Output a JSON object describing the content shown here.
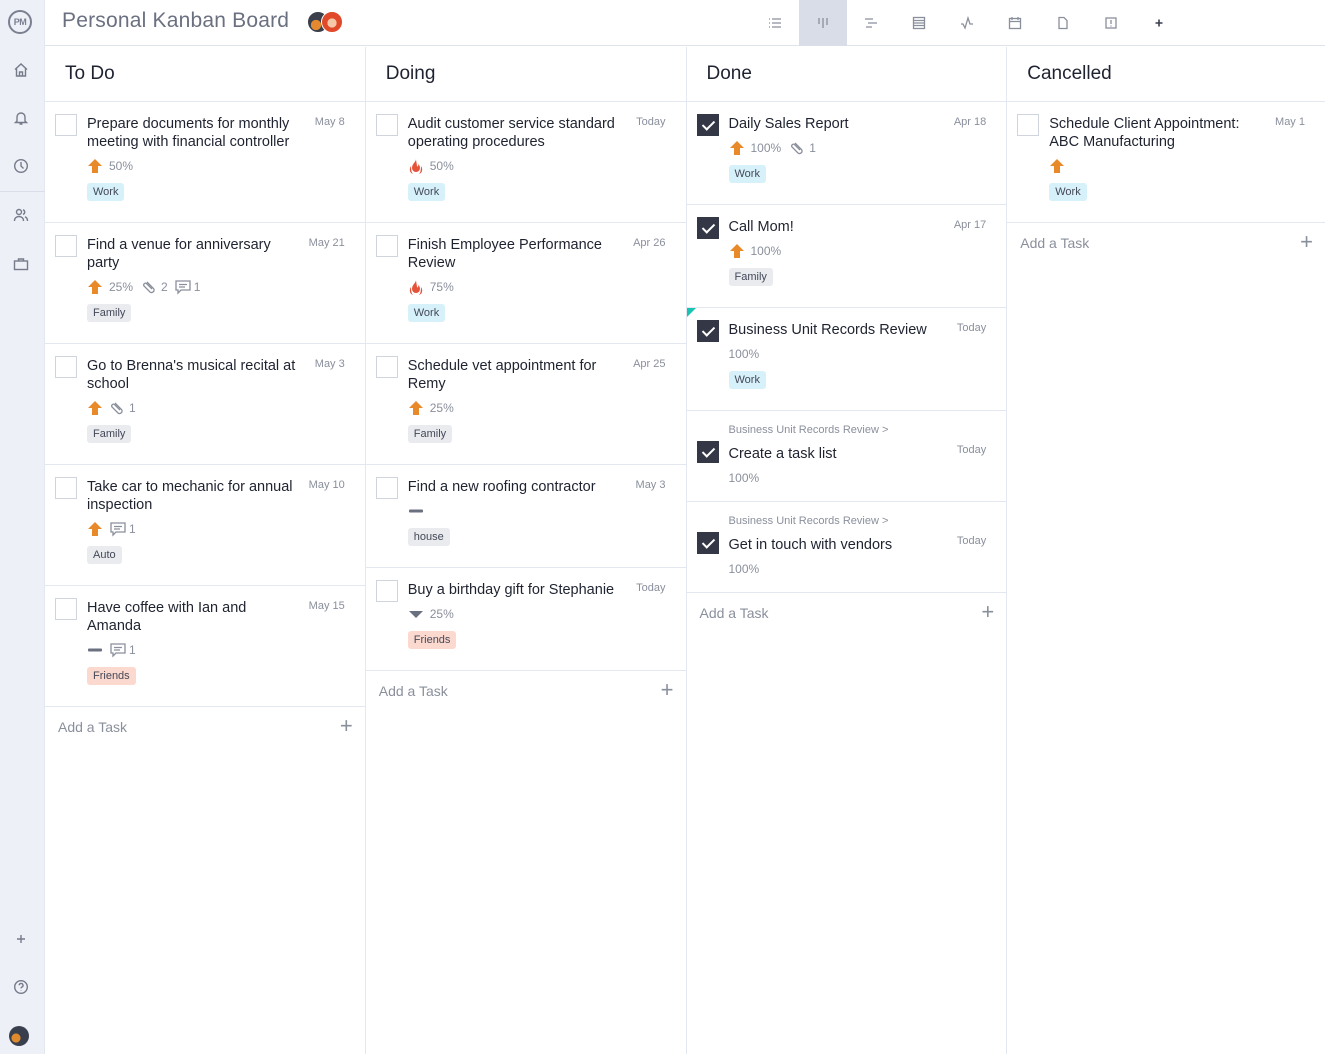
{
  "app": {
    "logo": "PM",
    "title": "Personal Kanban Board"
  },
  "sidebar": {
    "items": [
      {
        "icon": "home-icon",
        "label": "Home"
      },
      {
        "icon": "bell-icon",
        "label": "Notifications"
      },
      {
        "icon": "clock-icon",
        "label": "Recent"
      },
      {
        "icon": "users-icon",
        "label": "People"
      },
      {
        "icon": "briefcase-icon",
        "label": "Projects"
      }
    ],
    "bottom": [
      {
        "icon": "plus-icon",
        "label": "Add"
      },
      {
        "icon": "help-icon",
        "label": "Help"
      },
      {
        "icon": "user-avatar",
        "label": "Profile"
      }
    ]
  },
  "toolbar": {
    "views": [
      {
        "icon": "list-view-icon",
        "label": "List",
        "active": false
      },
      {
        "icon": "board-view-icon",
        "label": "Board",
        "active": true
      },
      {
        "icon": "gantt-view-icon",
        "label": "Gantt",
        "active": false
      },
      {
        "icon": "sheet-view-icon",
        "label": "Sheet",
        "active": false
      },
      {
        "icon": "dashboard-icon",
        "label": "Dashboard",
        "active": false
      },
      {
        "icon": "calendar-icon",
        "label": "Calendar",
        "active": false
      },
      {
        "icon": "files-icon",
        "label": "Files",
        "active": false
      },
      {
        "icon": "issues-icon",
        "label": "Issues",
        "active": false
      },
      {
        "icon": "add-view-icon",
        "label": "Add view",
        "active": false
      }
    ]
  },
  "columns": [
    {
      "title": "To Do",
      "add_label": "Add a Task",
      "cards": [
        {
          "name": "Prepare documents for monthly meeting with financial controller",
          "date": "May 8",
          "priority": "high",
          "progress": "50%",
          "attachments": null,
          "comments": null,
          "tag": "Work",
          "done": false
        },
        {
          "name": "Find a venue for anniversary party",
          "date": "May 21",
          "priority": "high",
          "progress": "25%",
          "attachments": "2",
          "comments": "1",
          "tag": "Family",
          "done": false
        },
        {
          "name": "Go to Brenna's musical recital at school",
          "date": "May 3",
          "priority": "high",
          "progress": null,
          "attachments": "1",
          "comments": null,
          "tag": "Family",
          "done": false
        },
        {
          "name": "Take car to mechanic for annual inspection",
          "date": "May 10",
          "priority": "high",
          "progress": null,
          "attachments": null,
          "comments": "1",
          "tag": "Auto",
          "done": false
        },
        {
          "name": "Have coffee with Ian and Amanda",
          "date": "May 15",
          "priority": "medium",
          "progress": null,
          "attachments": null,
          "comments": "1",
          "tag": "Friends",
          "done": false
        }
      ]
    },
    {
      "title": "Doing",
      "add_label": "Add a Task",
      "cards": [
        {
          "name": "Audit customer service standard operating procedures",
          "date": "Today",
          "priority": "critical",
          "progress": "50%",
          "attachments": null,
          "comments": null,
          "tag": "Work",
          "done": false
        },
        {
          "name": "Finish Employee Performance Review",
          "date": "Apr 26",
          "priority": "critical",
          "progress": "75%",
          "attachments": null,
          "comments": null,
          "tag": "Work",
          "done": false
        },
        {
          "name": "Schedule vet appointment for Remy",
          "date": "Apr 25",
          "priority": "high",
          "progress": "25%",
          "attachments": null,
          "comments": null,
          "tag": "Family",
          "done": false
        },
        {
          "name": "Find a new roofing contractor",
          "date": "May 3",
          "priority": "medium",
          "progress": null,
          "attachments": null,
          "comments": null,
          "tag": "house",
          "done": false
        },
        {
          "name": "Buy a birthday gift for Stephanie",
          "date": "Today",
          "priority": "low",
          "progress": "25%",
          "attachments": null,
          "comments": null,
          "tag": "Friends",
          "done": false
        }
      ]
    },
    {
      "title": "Done",
      "add_label": "Add a Task",
      "cards": [
        {
          "name": "Daily Sales Report",
          "date": "Apr 18",
          "priority": "high",
          "progress": "100%",
          "attachments": "1",
          "comments": null,
          "tag": "Work",
          "done": true
        },
        {
          "name": "Call Mom!",
          "date": "Apr 17",
          "priority": "high",
          "progress": "100%",
          "attachments": null,
          "comments": null,
          "tag": "Family",
          "done": true
        },
        {
          "name": "Business Unit Records Review",
          "date": "Today",
          "priority": null,
          "progress": "100%",
          "attachments": null,
          "comments": null,
          "tag": "Work",
          "done": true,
          "marker": true
        },
        {
          "parent": "Business Unit Records Review >",
          "name": "Create a task list",
          "date": "Today",
          "priority": null,
          "progress": "100%",
          "attachments": null,
          "comments": null,
          "tag": null,
          "done": true
        },
        {
          "parent": "Business Unit Records Review >",
          "name": "Get in touch with vendors",
          "date": "Today",
          "priority": null,
          "progress": "100%",
          "attachments": null,
          "comments": null,
          "tag": null,
          "done": true
        }
      ]
    },
    {
      "title": "Cancelled",
      "add_label": "Add a Task",
      "cards": [
        {
          "name": "Schedule Client Appointment: ABC Manufacturing",
          "date": "May 1",
          "priority": "high",
          "progress": null,
          "attachments": null,
          "comments": null,
          "tag": "Work",
          "done": false
        }
      ]
    }
  ],
  "colors": {
    "priority_high": "#e8892a",
    "priority_critical": "#e5533a",
    "priority_medium": "#6b7080",
    "priority_low": "#6b7080",
    "tag_work": "#d6f1fa",
    "tag_neutral": "#e9ebef",
    "tag_friends": "#fbd9cf",
    "checked": "#333746",
    "active_view": "#d8dde7",
    "marker": "#17c3b2"
  }
}
